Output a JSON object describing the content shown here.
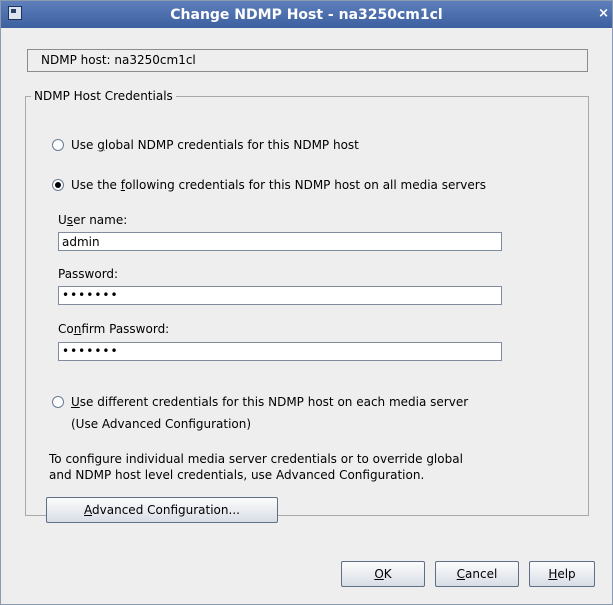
{
  "window": {
    "title": "Change NDMP Host - na3250cm1cl",
    "close_glyph": "×"
  },
  "host": {
    "label": "NDMP host:",
    "value": "na3250cm1cl"
  },
  "credentials": {
    "legend": "NDMP Host Credentials",
    "option_global": {
      "pre": "Use ",
      "mnemonic": "g",
      "post": "lobal NDMP credentials for this NDMP host",
      "selected": false
    },
    "option_following": {
      "pre": "Use the ",
      "mnemonic": "f",
      "post": "ollowing credentials for this NDMP host on all media servers",
      "selected": true
    },
    "username": {
      "pre": "U",
      "mnemonic": "s",
      "post": "er name:",
      "value": "admin"
    },
    "password": {
      "label": "Password:",
      "value": "•••••••"
    },
    "confirm": {
      "pre": "Co",
      "mnemonic": "n",
      "post": "firm Password:",
      "value": "•••••••"
    },
    "option_different": {
      "pre": "",
      "mnemonic": "U",
      "post": "se different credentials for this NDMP host on each media server",
      "line2": "(Use Advanced Configuration)",
      "selected": false
    },
    "info_line1": "To configure individual media server credentials or to override global",
    "info_line2": "and NDMP host level credentials, use Advanced Configuration.",
    "advanced_button": {
      "pre": "",
      "mnemonic": "A",
      "post": "dvanced Configuration..."
    }
  },
  "buttons": {
    "ok": {
      "mnemonic": "O",
      "post": "K"
    },
    "cancel": {
      "mnemonic": "C",
      "post": "ancel"
    },
    "help": {
      "mnemonic": "H",
      "post": "elp"
    }
  },
  "colors": {
    "titlebar": "#4a6cae",
    "dialog_bg": "#eeeeee"
  }
}
